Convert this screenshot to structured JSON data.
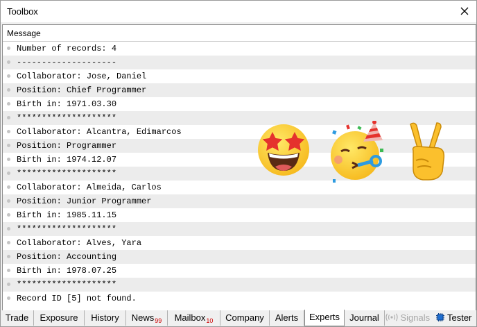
{
  "window": {
    "title": "Toolbox"
  },
  "column_header": "Message",
  "log": [
    "Number of records: 4",
    "--------------------",
    "Collaborator: Jose, Daniel",
    "Position: Chief Programmer",
    "Birth in: 1971.03.30",
    "********************",
    "Collaborator: Alcantra, Edimarcos",
    "Position: Programmer",
    "Birth in: 1974.12.07",
    "********************",
    "Collaborator: Almeida, Carlos",
    "Position: Junior Programmer",
    "Birth in: 1985.11.15",
    "********************",
    "Collaborator: Alves, Yara",
    "Position: Accounting",
    "Birth in: 1978.07.25",
    "********************",
    "Record ID [5] not found."
  ],
  "emojis": [
    "star-struck-face",
    "partying-face",
    "victory-hand"
  ],
  "tabs": {
    "trade": "Trade",
    "exposure": "Exposure",
    "history": "History",
    "news": "News",
    "news_count": "99",
    "mailbox": "Mailbox",
    "mailbox_count": "10",
    "company": "Company",
    "alerts": "Alerts",
    "experts": "Experts",
    "journal": "Journal",
    "signals": "Signals",
    "tester": "Tester"
  },
  "active_tab": "Experts"
}
